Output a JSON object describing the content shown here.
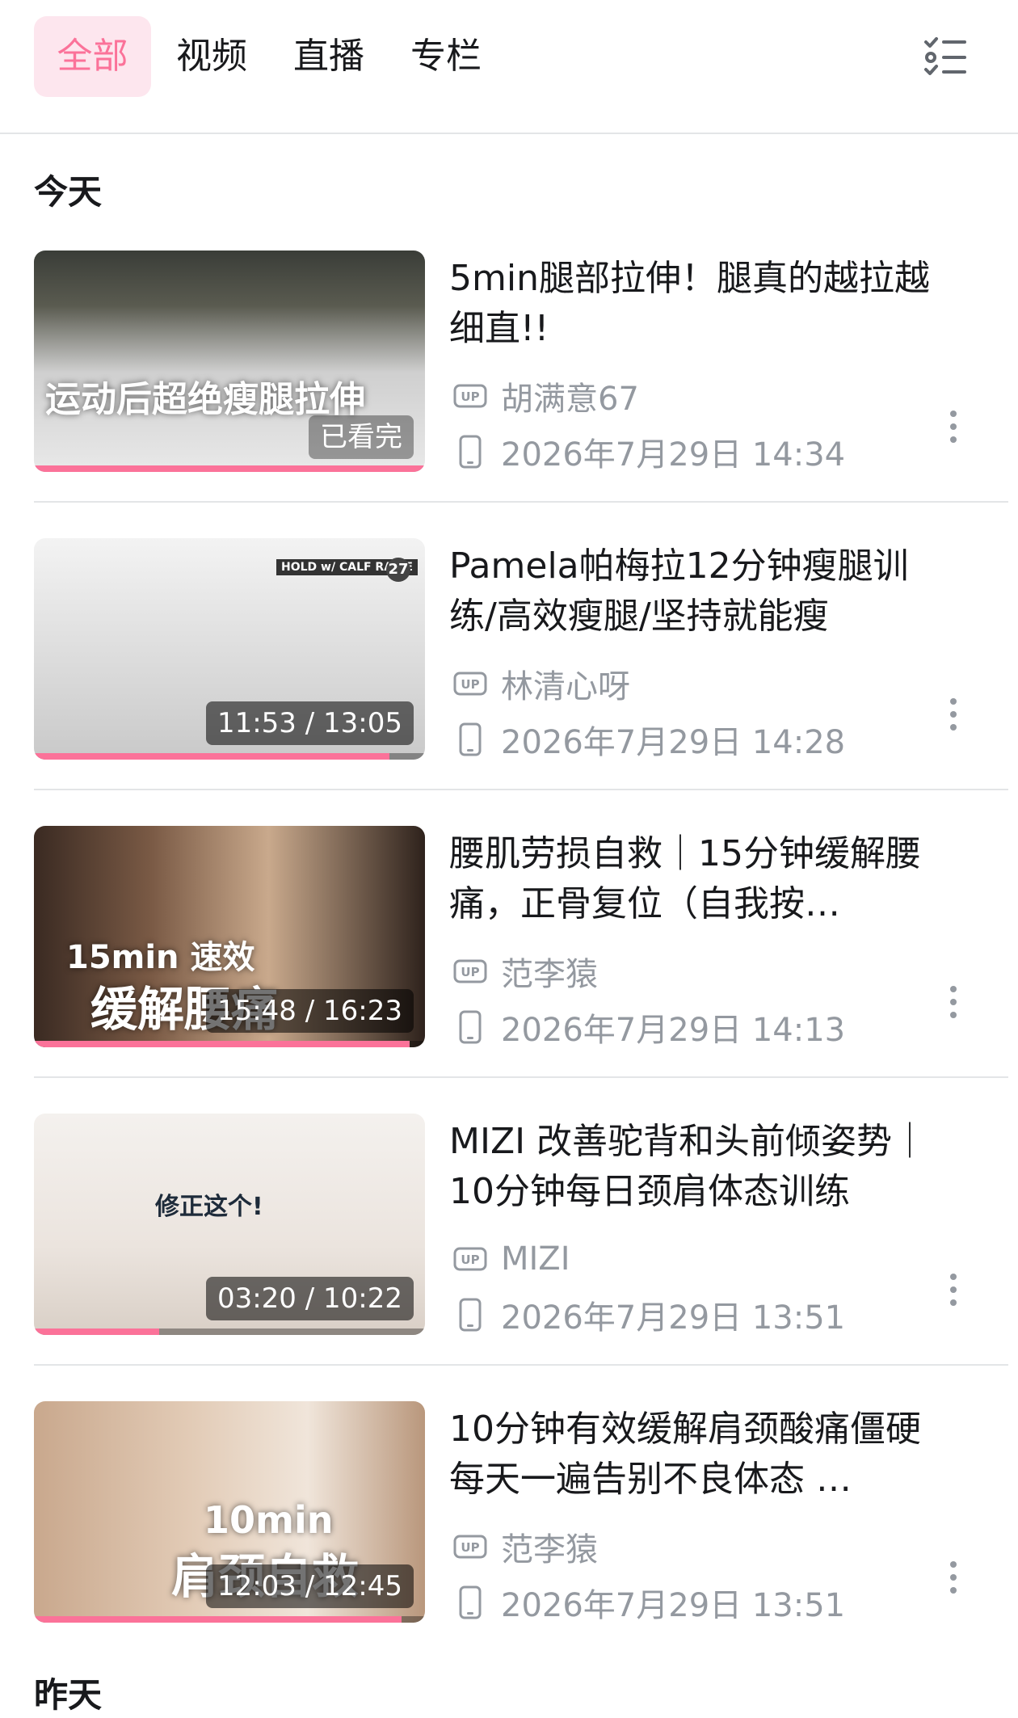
{
  "tabs": [
    {
      "label": "全部",
      "active": true
    },
    {
      "label": "视频",
      "active": false
    },
    {
      "label": "直播",
      "active": false
    },
    {
      "label": "专栏",
      "active": false
    }
  ],
  "menu_icon": "list-filter-icon",
  "sections": [
    {
      "title": "今天"
    },
    {
      "title": "昨天"
    }
  ],
  "accent_color": "#fb7299",
  "items": [
    {
      "title": "5min腿部拉伸！腿真的越拉越细直!!",
      "uploader": "胡满意67",
      "time": "2026年7月29日 14:34",
      "thumb_text": "运动后超绝瘦腿拉伸",
      "thumb_text2": "",
      "progress_label": "已看完",
      "progress": 1.0,
      "device_icon": "phone-icon"
    },
    {
      "title": "Pamela帕梅拉12分钟瘦腿训练/高效瘦腿/坚持就能瘦",
      "uploader": "林清心呀",
      "time": "2026年7月29日 14:28",
      "thumb_text": "HOLD w/ CALF RAISE",
      "thumb_text2": "27",
      "progress_label": "11:53 / 13:05",
      "progress": 0.91,
      "device_icon": "phone-icon"
    },
    {
      "title": "腰肌劳损自救｜15分钟缓解腰痛，正骨复位（自我按…",
      "uploader": "范李猿",
      "time": "2026年7月29日 14:13",
      "thumb_text": "15min 速效",
      "thumb_text2": "缓解腰痛",
      "progress_label": "15:48 / 16:23",
      "progress": 0.96,
      "device_icon": "phone-icon"
    },
    {
      "title": "MIZI 改善驼背和头前倾姿势｜10分钟每日颈肩体态训练",
      "uploader": "MIZI",
      "time": "2026年7月29日 13:51",
      "thumb_text": "修正这个!",
      "thumb_text2": "",
      "progress_label": "03:20 / 10:22",
      "progress": 0.32,
      "device_icon": "phone-icon"
    },
    {
      "title": "10分钟有效缓解肩颈酸痛僵硬 每天一遍告别不良体态 …",
      "uploader": "范李猿",
      "time": "2026年7月29日 13:51",
      "thumb_text": "10min",
      "thumb_text2": "肩颈自救",
      "progress_label": "12:03 / 12:45",
      "progress": 0.94,
      "device_icon": "phone-icon"
    }
  ]
}
